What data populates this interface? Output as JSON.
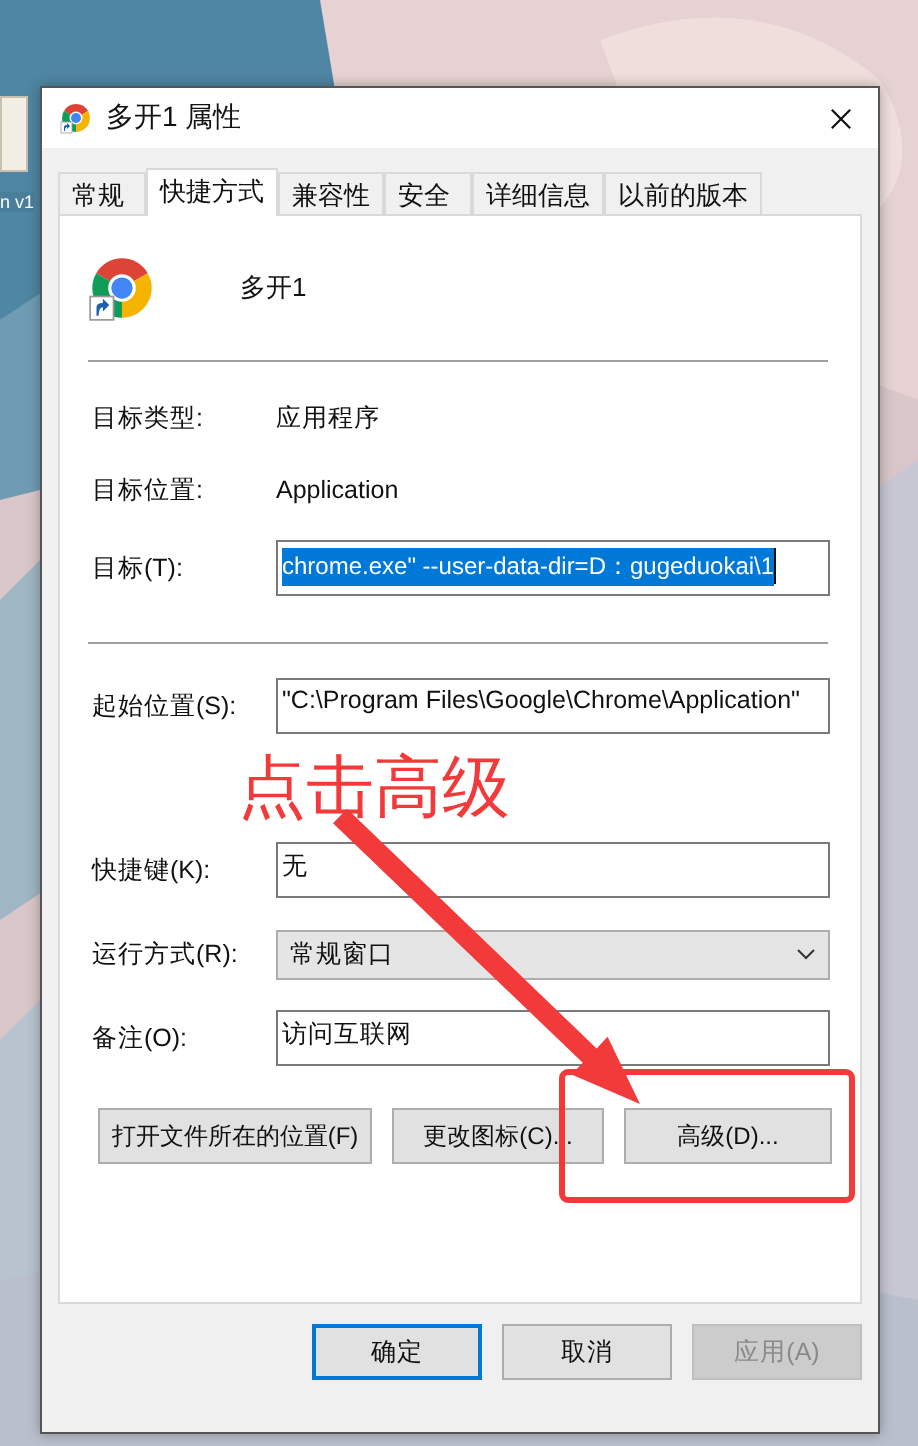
{
  "desktop": {
    "icon_label": "n v1"
  },
  "window": {
    "title": "多开1 属性"
  },
  "tabs": [
    {
      "label": "常规",
      "selected": false
    },
    {
      "label": "快捷方式",
      "selected": true
    },
    {
      "label": "兼容性",
      "selected": false
    },
    {
      "label": "安全",
      "selected": false
    },
    {
      "label": "详细信息",
      "selected": false
    },
    {
      "label": "以前的版本",
      "selected": false
    }
  ],
  "shortcut_name": "多开1",
  "groups": [
    [
      {
        "kind": "info",
        "label": "目标类型:",
        "value": "应用程序"
      },
      {
        "kind": "info",
        "label": "目标位置:",
        "value": "Application"
      },
      {
        "kind": "input",
        "label": "目标(T):",
        "value": "chrome.exe\" --user-data-dir=D：gugeduokai\\1",
        "highlighted": true
      }
    ],
    [
      {
        "kind": "input",
        "label": "起始位置(S):",
        "value": "\"C:\\Program Files\\Google\\Chrome\\Application\"",
        "highlighted": false
      },
      {
        "kind": "input",
        "label": "快捷键(K):",
        "value": "无",
        "highlighted": false
      },
      {
        "kind": "select",
        "label": "运行方式(R):",
        "value": "常规窗口"
      },
      {
        "kind": "input",
        "label": "备注(O):",
        "value": "访问互联网",
        "highlighted": false
      }
    ]
  ],
  "actions": [
    "打开文件所在的位置(F)",
    "更改图标(C)...",
    "高级(D)..."
  ],
  "dialog_buttons": [
    {
      "label": "确定",
      "default": true,
      "disabled": false
    },
    {
      "label": "取消",
      "default": false,
      "disabled": false
    },
    {
      "label": "应用(A)",
      "default": false,
      "disabled": true
    }
  ],
  "annotation": {
    "text": "点击高级"
  }
}
